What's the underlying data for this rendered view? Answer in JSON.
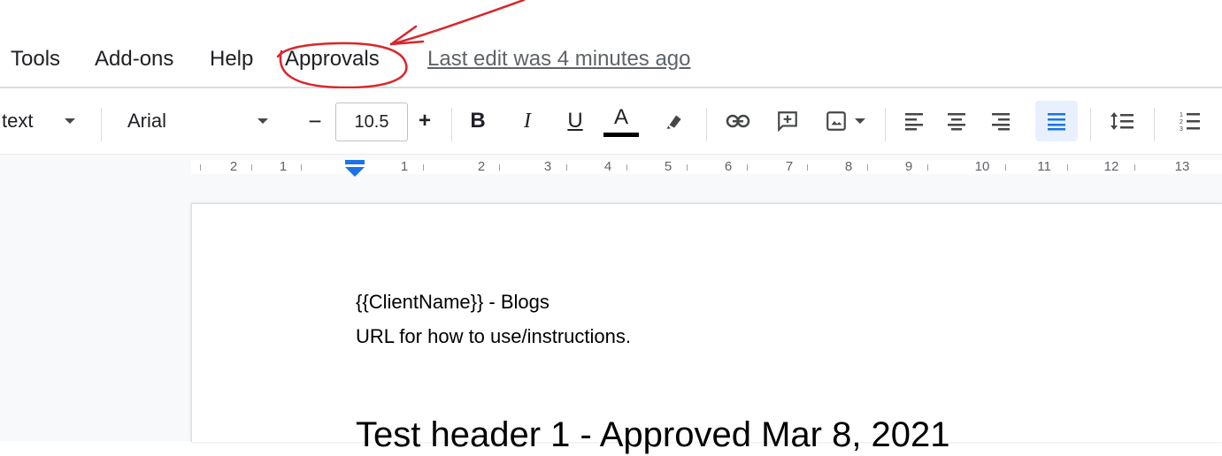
{
  "menu": {
    "items": [
      "Tools",
      "Add-ons",
      "Help",
      "Approvals"
    ],
    "last_edit": "Last edit was 4 minutes ago"
  },
  "toolbar": {
    "style_label": "text",
    "font_label": "Arial",
    "font_size": "10.5",
    "decrease_label": "−",
    "increase_label": "+",
    "bold_label": "B",
    "italic_label": "I",
    "underline_label": "U",
    "text_color_label": "A",
    "text_color": "#000000",
    "active_alignment": "justify"
  },
  "ruler": {
    "labels": [
      "2",
      "1",
      "1",
      "2",
      "3",
      "4",
      "5",
      "6",
      "7",
      "8",
      "9",
      "10",
      "11",
      "12",
      "13"
    ]
  },
  "document": {
    "line1": "{{ClientName}} - Blogs",
    "line2": "URL for how to use/instructions.",
    "heading": "Test header 1 - Approved Mar 8, 2021"
  },
  "colors": {
    "annotation": "#d9262b",
    "accent": "#1a73e8"
  }
}
